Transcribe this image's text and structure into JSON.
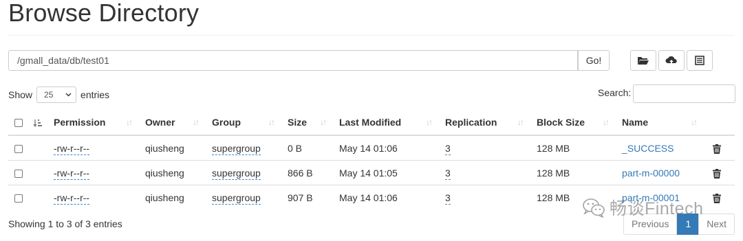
{
  "page": {
    "title": "Browse Directory"
  },
  "toolbar": {
    "path_value": "/gmall_data/db/test01",
    "go_label": "Go!",
    "icons": [
      "folder-open-icon",
      "upload-icon",
      "list-icon"
    ]
  },
  "controls": {
    "show_label": "Show",
    "entries_value": "25",
    "entries_label": "entries",
    "search_label": "Search:"
  },
  "table": {
    "headers": [
      "Permission",
      "Owner",
      "Group",
      "Size",
      "Last Modified",
      "Replication",
      "Block Size",
      "Name"
    ],
    "rows": [
      {
        "permission": "-rw-r--r--",
        "owner": "qiusheng",
        "group": "supergroup",
        "size": "0 B",
        "modified": "May 14 01:06",
        "replication": "3",
        "block_size": "128 MB",
        "name": "_SUCCESS"
      },
      {
        "permission": "-rw-r--r--",
        "owner": "qiusheng",
        "group": "supergroup",
        "size": "866 B",
        "modified": "May 14 01:05",
        "replication": "3",
        "block_size": "128 MB",
        "name": "part-m-00000"
      },
      {
        "permission": "-rw-r--r--",
        "owner": "qiusheng",
        "group": "supergroup",
        "size": "907 B",
        "modified": "May 14 01:06",
        "replication": "3",
        "block_size": "128 MB",
        "name": "part-m-00001"
      }
    ]
  },
  "footer": {
    "info": "Showing 1 to 3 of 3 entries",
    "prev_label": "Previous",
    "current_page": "1",
    "next_label": "Next"
  },
  "watermark": {
    "text": "畅谈Fintech"
  },
  "colors": {
    "link": "#337ab7",
    "active_page": "#337ab7"
  }
}
